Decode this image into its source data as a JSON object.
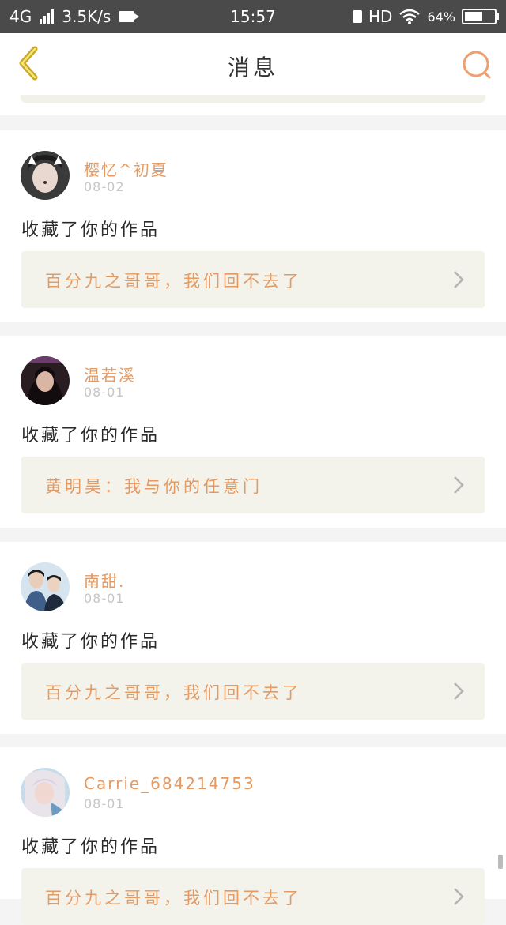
{
  "status_bar": {
    "network": "4G",
    "speed": "3.5K/s",
    "time": "15:57",
    "hd": "HD",
    "battery": "64%"
  },
  "header": {
    "title": "消息",
    "back_icon": "chevron-left-icon",
    "search_icon": "search-icon"
  },
  "colors": {
    "accent": "#e39a63",
    "back_icon": "#c9a624",
    "card_bg": "#f3f3ec",
    "page_bg": "#f4f4f4"
  },
  "notifications": [
    {
      "username": "樱忆^初夏",
      "date": "08-02",
      "action": "收藏了你的作品",
      "work_title": "百分九之哥哥，我们回不去了"
    },
    {
      "username": "温若溪",
      "date": "08-01",
      "action": "收藏了你的作品",
      "work_title": "黄明昊：我与你的任意门"
    },
    {
      "username": "南甜.",
      "date": "08-01",
      "action": "收藏了你的作品",
      "work_title": "百分九之哥哥，我们回不去了"
    },
    {
      "username": "Carrie_684214753",
      "date": "08-01",
      "action": "收藏了你的作品",
      "work_title": "百分九之哥哥，我们回不去了"
    }
  ]
}
